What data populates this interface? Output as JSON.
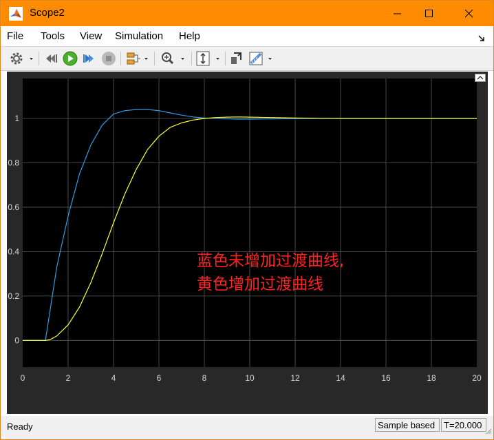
{
  "window": {
    "title": "Scope2",
    "border_color": "#e0861a",
    "titlebar_color": "#ff8c00"
  },
  "menu": [
    "File",
    "Tools",
    "View",
    "Simulation",
    "Help"
  ],
  "toolbar": {
    "buttons": [
      "settings-icon",
      "step-back-icon",
      "run-icon",
      "step-forward-icon",
      "stop-icon",
      "signal-selector-icon",
      "zoom-in-icon",
      "autoscale-icon",
      "highlight-simulink-block-icon",
      "measurements-icon"
    ]
  },
  "chart_data": {
    "type": "line",
    "xlim": [
      0,
      20
    ],
    "ylim": [
      -0.12,
      1.18
    ],
    "xticks": [
      0,
      2,
      4,
      6,
      8,
      10,
      12,
      14,
      16,
      18,
      20
    ],
    "yticks": [
      0,
      0.2,
      0.4,
      0.6,
      0.8,
      1
    ],
    "xtick_labels": [
      "0",
      "2",
      "4",
      "6",
      "8",
      "10",
      "12",
      "14",
      "16",
      "18",
      "20"
    ],
    "ytick_labels": [
      "0",
      "0.2",
      "0.4",
      "0.6",
      "0.8",
      "1"
    ],
    "grid": true,
    "background": "#000000",
    "series": [
      {
        "color": "#2e9ee6",
        "x": [
          0,
          1,
          1.5,
          2,
          2.5,
          3,
          3.5,
          4,
          4.5,
          5,
          5.5,
          6,
          6.5,
          7,
          7.5,
          8,
          8.5,
          9,
          9.5,
          10,
          11,
          12,
          13,
          14,
          16,
          18,
          20
        ],
        "y": [
          0,
          0,
          0.33,
          0.56,
          0.75,
          0.88,
          0.97,
          1.02,
          1.035,
          1.04,
          1.04,
          1.035,
          1.025,
          1.015,
          1.007,
          1.002,
          1.0,
          0.998,
          0.997,
          0.997,
          0.998,
          0.999,
          1.0,
          1.0,
          1.0,
          1.0,
          1.0
        ]
      },
      {
        "color": "#ffff33",
        "x": [
          0,
          1,
          1.2,
          1.5,
          2,
          2.5,
          3,
          3.5,
          4,
          4.5,
          5,
          5.5,
          6,
          6.5,
          7,
          7.5,
          8,
          8.5,
          9,
          9.5,
          10,
          11,
          12,
          13,
          14,
          16,
          18,
          20
        ],
        "y": [
          0,
          0,
          0.003,
          0.02,
          0.07,
          0.15,
          0.26,
          0.39,
          0.53,
          0.66,
          0.77,
          0.86,
          0.92,
          0.96,
          0.98,
          0.993,
          1.0,
          1.004,
          1.006,
          1.007,
          1.006,
          1.004,
          1.002,
          1.001,
          1.0,
          1.0,
          1.0,
          1.0
        ]
      }
    ],
    "annotation": {
      "lines": [
        "蓝色未增加过渡曲线,",
        "黄色增加过渡曲线"
      ],
      "color": "#ff2020"
    }
  },
  "status": {
    "left": "Ready",
    "mode": "Sample based",
    "time": "T=20.000"
  }
}
